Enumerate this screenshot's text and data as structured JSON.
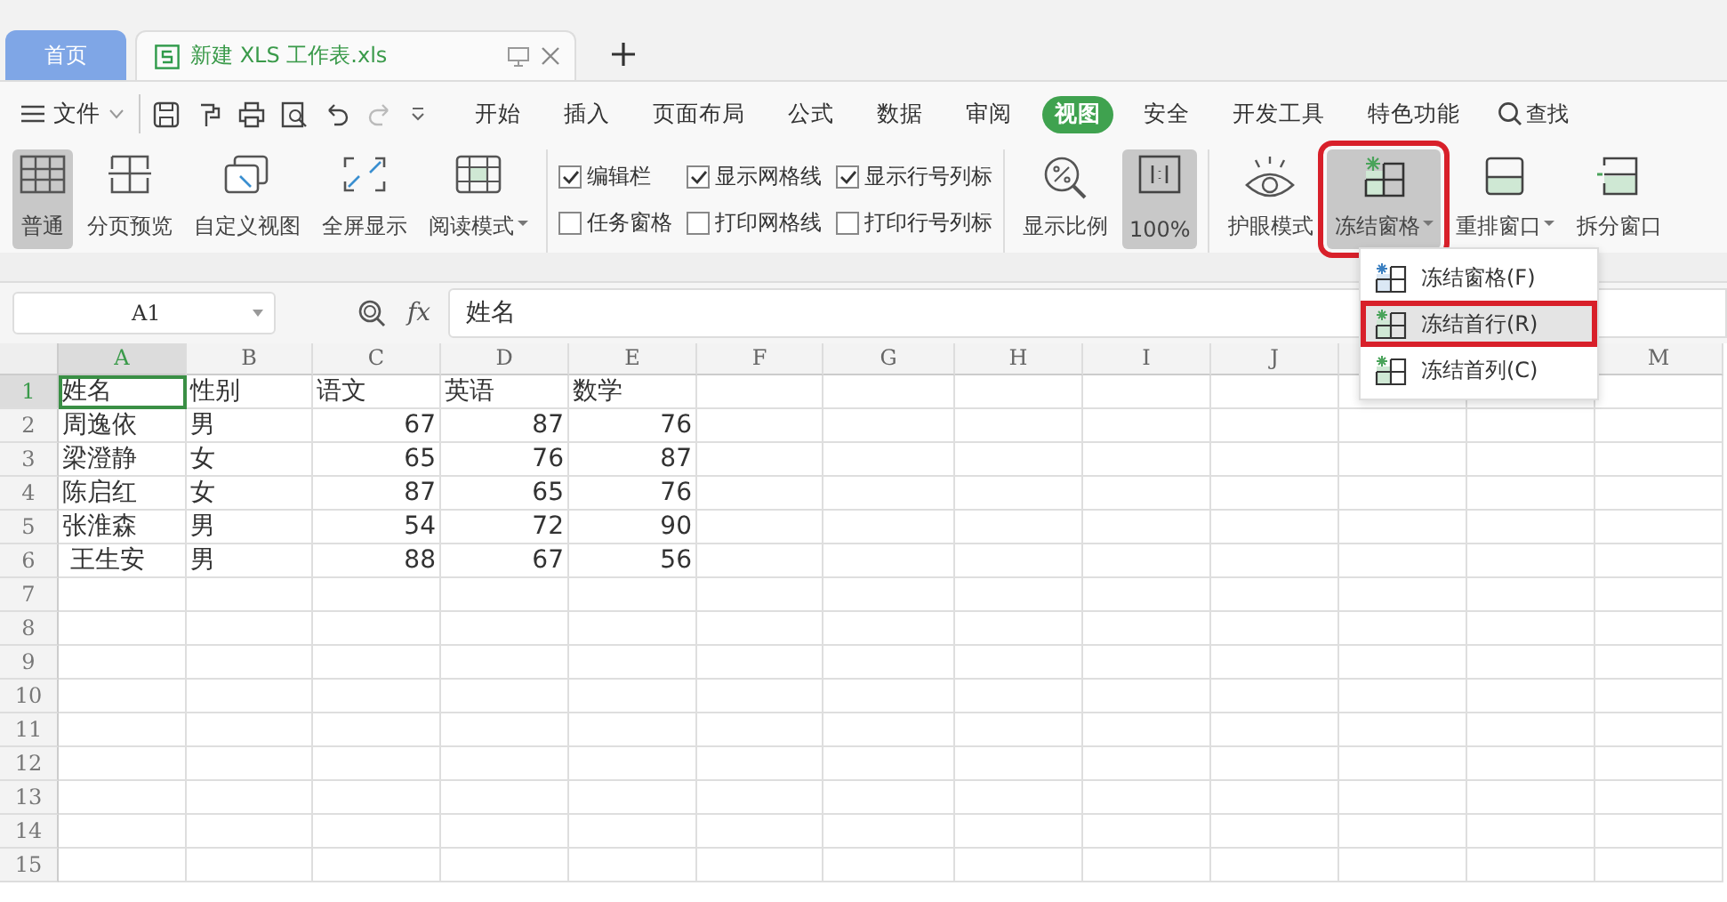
{
  "tabs": [
    {
      "label": "首页",
      "kind": "home",
      "selected": false
    },
    {
      "label": "新建 XLS 工作表.xls",
      "kind": "document",
      "selected": true
    }
  ],
  "menu": {
    "file": "文件",
    "tabs": [
      {
        "label": "开始",
        "selected": false
      },
      {
        "label": "插入",
        "selected": false
      },
      {
        "label": "页面布局",
        "selected": false
      },
      {
        "label": "公式",
        "selected": false
      },
      {
        "label": "数据",
        "selected": false
      },
      {
        "label": "审阅",
        "selected": false
      },
      {
        "label": "视图",
        "selected": true
      },
      {
        "label": "安全",
        "selected": false
      },
      {
        "label": "开发工具",
        "selected": false
      },
      {
        "label": "特色功能",
        "selected": false
      }
    ],
    "search": "查找"
  },
  "ribbon": {
    "view_buttons": [
      {
        "label": "普通",
        "selected": true,
        "dropdown": false
      },
      {
        "label": "分页预览",
        "selected": false,
        "dropdown": false
      },
      {
        "label": "自定义视图",
        "selected": false,
        "dropdown": false
      },
      {
        "label": "全屏显示",
        "selected": false,
        "dropdown": false
      },
      {
        "label": "阅读模式",
        "selected": false,
        "dropdown": true
      }
    ],
    "checkboxes": [
      {
        "label": "编辑栏",
        "checked": true
      },
      {
        "label": "任务窗格",
        "checked": false
      },
      {
        "label": "显示网格线",
        "checked": true
      },
      {
        "label": "打印网格线",
        "checked": false
      },
      {
        "label": "显示行号列标",
        "checked": true
      },
      {
        "label": "打印行号列标",
        "checked": false
      }
    ],
    "zoom_buttons": [
      {
        "label": "显示比例",
        "selected": false
      },
      {
        "label": "100%",
        "selected": true
      }
    ],
    "window_buttons": [
      {
        "label": "护眼模式",
        "selected": false,
        "dropdown": false,
        "highlighted": false
      },
      {
        "label": "冻结窗格",
        "selected": true,
        "dropdown": true,
        "highlighted": true
      },
      {
        "label": "重排窗口",
        "selected": false,
        "dropdown": true,
        "highlighted": false
      },
      {
        "label": "拆分窗口",
        "selected": false,
        "dropdown": false,
        "highlighted": false
      }
    ]
  },
  "formula_bar": {
    "cell_name": "A1",
    "function_label": "fx",
    "content": "姓名"
  },
  "sheet": {
    "column_headers": [
      {
        "label": "A",
        "selected": true
      },
      {
        "label": "B",
        "selected": false
      },
      {
        "label": "C",
        "selected": false
      },
      {
        "label": "D",
        "selected": false
      },
      {
        "label": "E",
        "selected": false
      },
      {
        "label": "F",
        "selected": false
      },
      {
        "label": "G",
        "selected": false
      },
      {
        "label": "H",
        "selected": false
      },
      {
        "label": "I",
        "selected": false
      },
      {
        "label": "J",
        "selected": false
      }
    ],
    "column_headers_right": [
      {
        "label": "M",
        "selected": false
      }
    ],
    "rows": [
      {
        "number": "1",
        "selected": true,
        "cells": [
          "姓名",
          "性别",
          "语文",
          "英语",
          "数学"
        ]
      },
      {
        "number": "2",
        "selected": false,
        "cells": [
          "周逸依",
          "男",
          "67",
          "87",
          "76"
        ]
      },
      {
        "number": "3",
        "selected": false,
        "cells": [
          "梁澄静",
          "女",
          "65",
          "76",
          "87"
        ]
      },
      {
        "number": "4",
        "selected": false,
        "cells": [
          "陈启红",
          "女",
          "87",
          "65",
          "76"
        ]
      },
      {
        "number": "5",
        "selected": false,
        "cells": [
          "张淮森",
          "男",
          "54",
          "72",
          "90"
        ]
      },
      {
        "number": "6",
        "selected": false,
        "cells": [
          " 王生安",
          "男",
          "88",
          "67",
          "56"
        ]
      },
      {
        "number": "7",
        "selected": false,
        "cells": []
      },
      {
        "number": "8",
        "selected": false,
        "cells": []
      },
      {
        "number": "9",
        "selected": false,
        "cells": []
      },
      {
        "number": "10",
        "selected": false,
        "cells": []
      },
      {
        "number": "11",
        "selected": false,
        "cells": []
      },
      {
        "number": "12",
        "selected": false,
        "cells": []
      },
      {
        "number": "13",
        "selected": false,
        "cells": []
      },
      {
        "number": "14",
        "selected": false,
        "cells": []
      },
      {
        "number": "15",
        "selected": false,
        "cells": []
      }
    ]
  },
  "dropdown_menu": [
    {
      "label": "冻结窗格(F)",
      "selected": false,
      "highlighted": false
    },
    {
      "label": "冻结首行(R)",
      "selected": true,
      "highlighted": true
    },
    {
      "label": "冻结首列(C)",
      "selected": false,
      "highlighted": false
    }
  ]
}
